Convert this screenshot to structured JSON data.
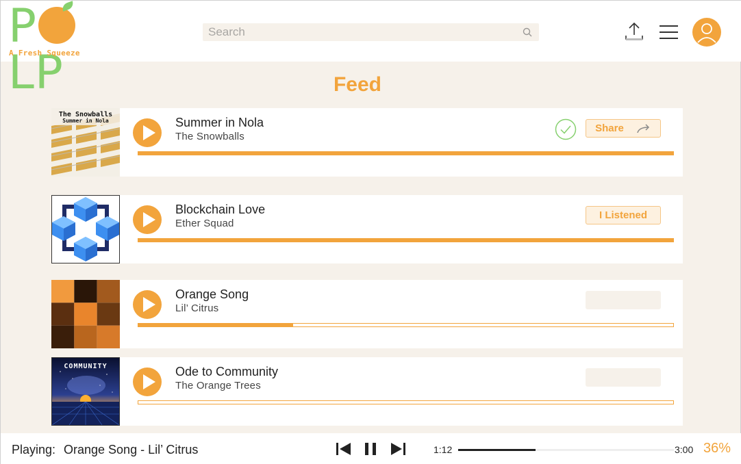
{
  "header": {
    "logo_text": "POLP",
    "logo_tagline": "A Fresh Squeeze",
    "search_placeholder": "Search",
    "icons": {
      "search": "search-icon",
      "upload": "upload-icon",
      "menu": "hamburger-menu-icon",
      "avatar": "user-avatar-icon"
    }
  },
  "feed": {
    "title": "Feed",
    "items": [
      {
        "title": "Summer in Nola",
        "artist": "The Snowballs",
        "cover_text_1": "The Snowballs",
        "cover_text_2": "Summer in Nola",
        "progress": 1.0,
        "listened_check": true,
        "action_label": "Share",
        "action_icon": "share-arrow-icon"
      },
      {
        "title": "Blockchain Love",
        "artist": "Ether Squad",
        "progress": 1.0,
        "listened_check": false,
        "action_label": "I Listened"
      },
      {
        "title": "Orange Song",
        "artist": "Lil’ Citrus",
        "progress": 0.29,
        "listened_check": false,
        "action_label": ""
      },
      {
        "title": "Ode to Community",
        "artist": "The Orange Trees",
        "cover_text_1": "COMMUNITY",
        "progress": 0.0,
        "listened_check": false,
        "action_label": ""
      }
    ]
  },
  "player": {
    "playing_label": "Playing:",
    "now_playing": "Orange Song - Lil’ Citrus",
    "elapsed": "1:12",
    "duration": "3:00",
    "percent": "36%",
    "progress": 0.36
  },
  "colors": {
    "accent": "#f2a43c",
    "logo_green": "#86d06e",
    "background": "#f6f1ea"
  }
}
